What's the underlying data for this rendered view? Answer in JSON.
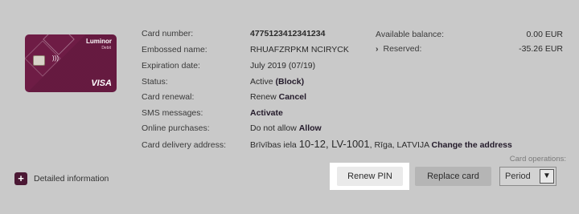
{
  "card": {
    "brand": "Luminor",
    "sub": "Debit",
    "network": "VISA",
    "color": "#6e1c45"
  },
  "fields": [
    {
      "label": "Card number:",
      "value": "4775123412341234"
    },
    {
      "label": "Embossed name:",
      "value": "RHUAFZRPKM NCIRYCK"
    },
    {
      "label": "Expiration date:",
      "value": "July 2019 (07/19)"
    },
    {
      "label": "Status:",
      "value": "Active",
      "action": "(Block)"
    },
    {
      "label": "Card renewal:",
      "value": "Renew",
      "action": "Cancel"
    },
    {
      "label": "SMS messages:",
      "value": "",
      "action": "Activate"
    },
    {
      "label": "Online purchases:",
      "value": "Do not allow",
      "action": "Allow"
    },
    {
      "label": "Card delivery address:",
      "value_prefix": "Brīvības iela",
      "value_big": "10-12, LV-1001",
      "value_suffix": ", Rīga, LATVIJA",
      "action": "Change the address"
    }
  ],
  "balances": {
    "available_label": "Available balance:",
    "available_value": "0.00 EUR",
    "reserved_label": "Reserved:",
    "reserved_value": "-35.26 EUR"
  },
  "details_label": "Detailed information",
  "buttons": {
    "renew_pin": "Renew PIN",
    "replace_card": "Replace card"
  },
  "operations": {
    "label": "Card operations:",
    "selected": "Period"
  }
}
